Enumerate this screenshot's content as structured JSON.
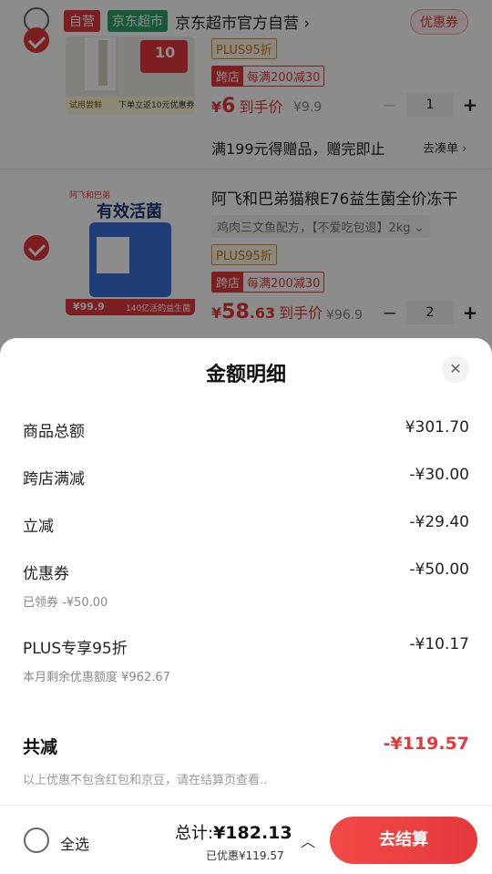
{
  "shop": {
    "tag_self": "自营",
    "tag_market": "京东超市",
    "name": "京东超市官方自营 ›",
    "coupon_btn": "优惠券"
  },
  "item1": {
    "thumb_badge": "10",
    "thumb_caption_left": "试用尝鲜",
    "thumb_caption_right": "下单立返10元优惠券",
    "plus_tag": "PLUS95折",
    "cross_a": "跨店",
    "cross_b": "每满200减30",
    "price_sym": "¥",
    "price_int": "6",
    "price_hand": "到手价",
    "orig_price": "¥9.9",
    "minus": "−",
    "qty": "1",
    "plus": "+",
    "gift_text": "满199元得赠品，赠完即止",
    "gift_link": "去凑单 ›"
  },
  "item2": {
    "title": "阿飞和巴弟猫粮E76益生菌全价冻干",
    "spec": "鸡肉三文鱼配方，【不爱吃包退】2kg ⌄",
    "thumb_brand": "阿飞和巴弟",
    "thumb_headline": "有效活菌",
    "thumb_price": "¥99.9",
    "thumb_caption": "140亿活的益生菌",
    "plus_tag": "PLUS95折",
    "cross_a": "跨店",
    "cross_b": "每满200减30",
    "price_sym": "¥",
    "price_int": "58",
    "price_dec": ".63",
    "price_hand": "到手价",
    "orig_price": "¥96.9",
    "minus": "−",
    "qty": "2",
    "plus": "+"
  },
  "sheet": {
    "title": "金额明细",
    "close": "✕",
    "rows": [
      {
        "label": "商品总额",
        "value": "¥301.70"
      },
      {
        "label": "跨店满减",
        "value": "-¥30.00"
      },
      {
        "label": "立减",
        "value": "-¥29.40"
      },
      {
        "label": "优惠券",
        "value": "-¥50.00",
        "sub": "已领券 -¥50.00"
      },
      {
        "label": "PLUS专享95折",
        "value": "-¥10.17",
        "sub": "本月剩余优惠额度 ¥962.67"
      }
    ],
    "total_label": "共减",
    "total_value": "-¥119.57",
    "note": "以上优惠不包含红包和京豆，请在结算页查看.."
  },
  "bottom": {
    "select_all": "全选",
    "sum_label": "总计:",
    "sum_value": "¥182.13",
    "saved": "已优惠¥119.57",
    "chevron": "︿",
    "checkout": "去结算"
  },
  "colors": {
    "accent": "#e4393c",
    "market_green": "#2ca36b",
    "plus_gold": "#c47a12"
  }
}
